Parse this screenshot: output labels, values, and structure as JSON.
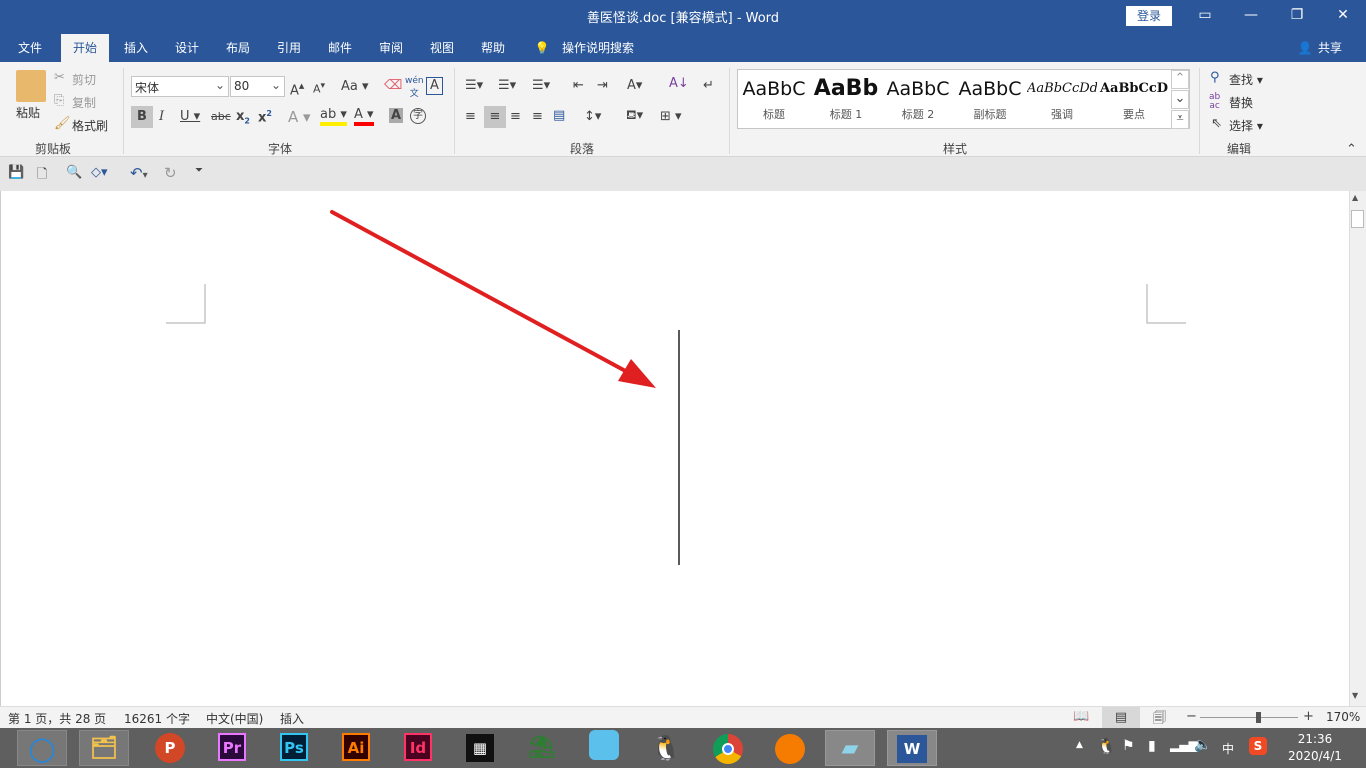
{
  "window": {
    "title": "善医怪谈.doc [兼容模式]  -  Word",
    "login": "登录",
    "restore_icon": "ribbon-display-icon",
    "min": "—",
    "max": "❐",
    "close": "✕"
  },
  "tabs": [
    "文件",
    "开始",
    "插入",
    "设计",
    "布局",
    "引用",
    "邮件",
    "审阅",
    "视图",
    "帮助"
  ],
  "tell_me": "操作说明搜索",
  "share": "共享",
  "clipboard": {
    "paste": "粘贴",
    "cut": "剪切",
    "copy": "复制",
    "format_painter": "格式刷",
    "group": "剪贴板"
  },
  "font": {
    "name": "宋体",
    "size": "80",
    "group": "字体",
    "aa": "Aa",
    "wen": "wén"
  },
  "paragraph": {
    "group": "段落"
  },
  "styles": {
    "group": "样式",
    "items": [
      {
        "sample": "AaBbC",
        "name": "标题"
      },
      {
        "sample": "AaBb",
        "name": "标题 1"
      },
      {
        "sample": "AaBbC",
        "name": "标题 2"
      },
      {
        "sample": "AaBbC",
        "name": "副标题"
      },
      {
        "sample": "AaBbCcDd",
        "name": "强调"
      },
      {
        "sample": "AaBbCcD",
        "name": "要点"
      }
    ]
  },
  "editing": {
    "find": "查找",
    "replace": "替换",
    "select": "选择",
    "group": "编辑"
  },
  "status": {
    "page": "第 1 页，共 28 页",
    "words": "16261 个字",
    "language": "中文(中国)",
    "mode": "插入",
    "zoom": "170%",
    "zoom_value": 170
  },
  "taskbar": {
    "apps": [
      {
        "label": "",
        "color": "#1e88e5"
      },
      {
        "label": "",
        "color": "#f2c14e"
      },
      {
        "label": "P",
        "color": "#d24726"
      },
      {
        "label": "Pr",
        "color": "#ea77ff"
      },
      {
        "label": "Ps",
        "color": "#31c5f0"
      },
      {
        "label": "Ai",
        "color": "#ff7c00"
      },
      {
        "label": "Id",
        "color": "#ff3366"
      },
      {
        "label": "▦",
        "color": "#fff"
      },
      {
        "label": "",
        "color": "#2e7d32"
      },
      {
        "label": "",
        "color": "#5bc0eb"
      },
      {
        "label": "",
        "color": "#000"
      },
      {
        "label": "",
        "color": "#4285f4"
      },
      {
        "label": "",
        "color": "#f57c00"
      },
      {
        "label": "",
        "color": "#8fd3e8"
      },
      {
        "label": "W",
        "color": "#2b579a"
      }
    ],
    "ime": "中",
    "time": "21:36",
    "date": "2020/4/1"
  },
  "colors": {
    "accent": "#2b579a",
    "arrow": "#e02020"
  }
}
